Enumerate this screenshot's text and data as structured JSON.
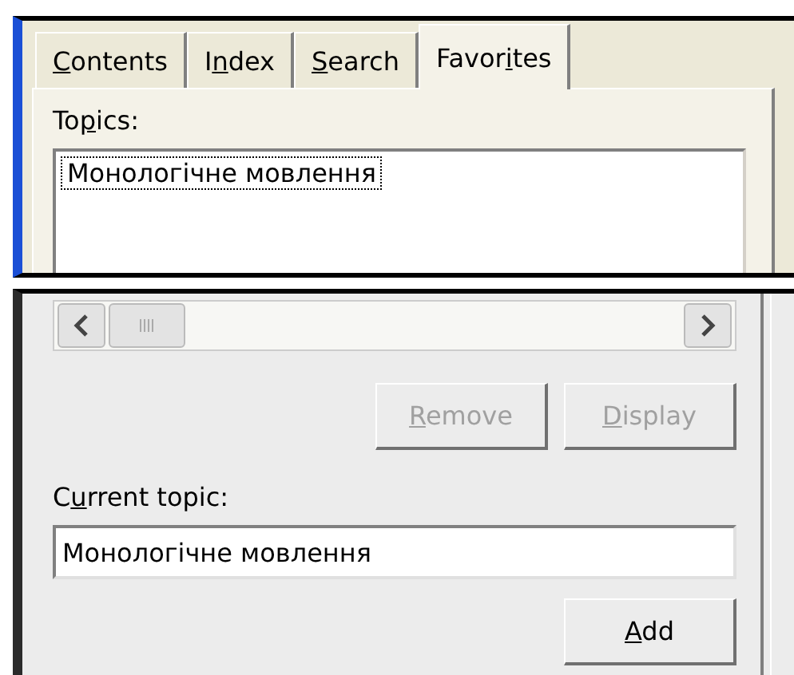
{
  "tabs": [
    {
      "label": {
        "key": "C",
        "post": "ontents"
      },
      "selected": false
    },
    {
      "label": {
        "pre": "I",
        "key": "n",
        "post": "dex"
      },
      "selected": false
    },
    {
      "label": {
        "key": "S",
        "post": "earch"
      },
      "selected": false
    },
    {
      "label": {
        "pre": "Favor",
        "key": "i",
        "post": "tes"
      },
      "selected": true
    }
  ],
  "topics_label": {
    "pre": "To",
    "key": "p",
    "post": "ics:"
  },
  "topics": [
    {
      "label": "Монологічне мовлення",
      "focused": true
    }
  ],
  "list_buttons": [
    {
      "label": {
        "key": "R",
        "post": "emove"
      },
      "disabled": true
    },
    {
      "label": {
        "key": "D",
        "post": "isplay"
      },
      "disabled": true
    }
  ],
  "current_topic_label": {
    "pre": "C",
    "key": "u",
    "post": "rrent topic:"
  },
  "current_topic": {
    "value": "Монологічне мовлення"
  },
  "add_button": {
    "label": {
      "key": "A",
      "post": "dd"
    },
    "disabled": false
  }
}
